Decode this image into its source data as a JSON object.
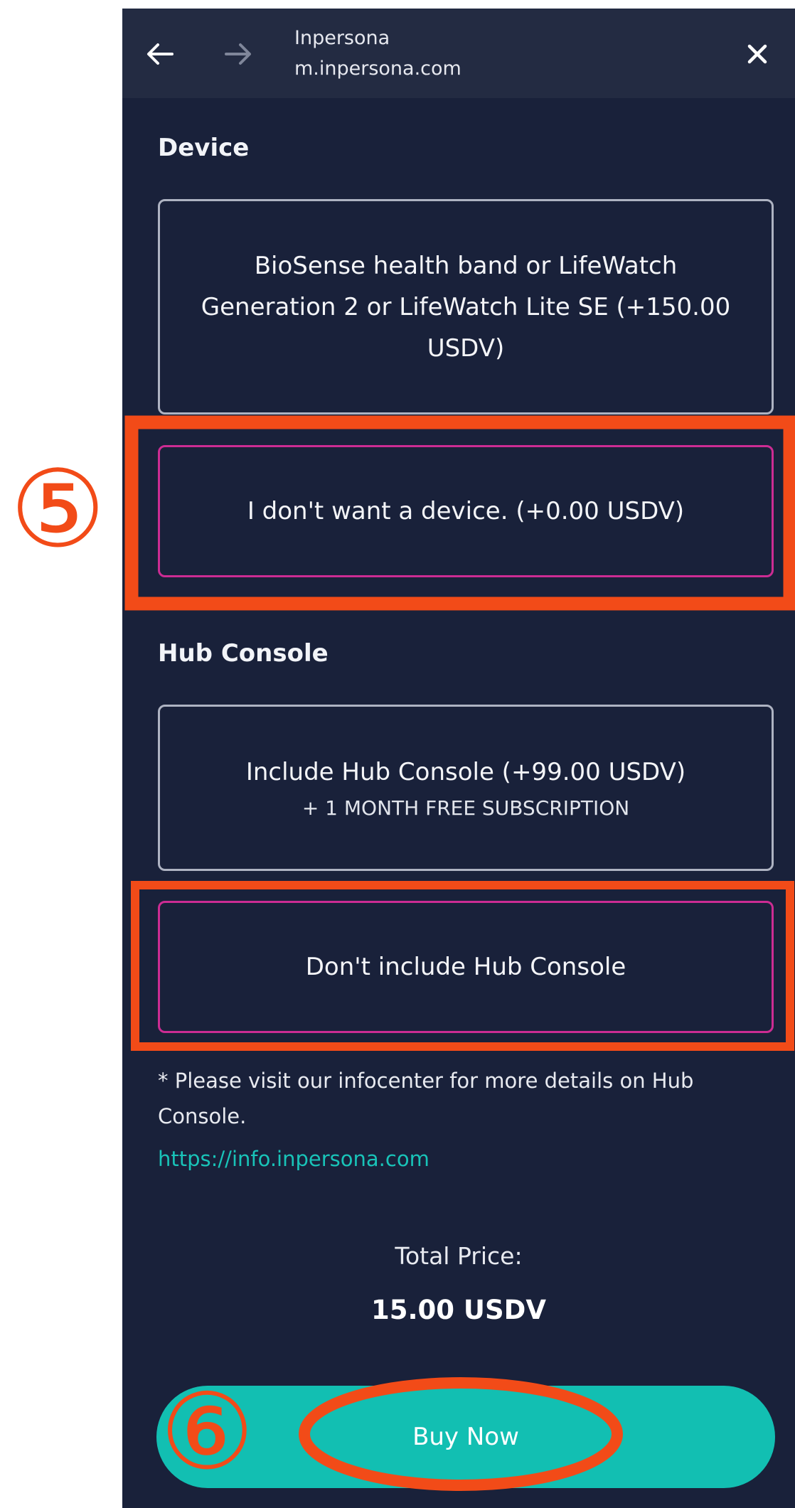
{
  "browser": {
    "site_title": "Inpersona",
    "site_url": "m.inpersona.com",
    "back_icon": "arrow-left-icon",
    "forward_icon": "arrow-right-icon",
    "close_icon": "close-icon"
  },
  "device": {
    "title": "Device",
    "options": [
      {
        "label": "BioSense health band or LifeWatch Generation 2 or LifeWatch Lite SE (+150.00 USDV)",
        "selected": false
      },
      {
        "label": "I don't want a device. (+0.00 USDV)",
        "selected": true
      }
    ]
  },
  "hub": {
    "title": "Hub Console",
    "options": [
      {
        "label": "Include Hub Console (+99.00 USDV)",
        "sublabel": "+ 1 MONTH FREE SUBSCRIPTION",
        "selected": false
      },
      {
        "label": "Don't include Hub Console",
        "selected": true
      }
    ],
    "note": "* Please visit our infocenter for more details on Hub Console.",
    "link": "https://info.inpersona.com"
  },
  "total": {
    "label": "Total Price:",
    "value": "15.00 USDV"
  },
  "buy_button": "Buy Now",
  "annotations": {
    "step5": "⑤",
    "step6": "⑥"
  },
  "colors": {
    "page_background": "#19213a",
    "top_bar": "#232b42",
    "selected_border": "#cc2c93",
    "accent_teal": "#12bfb2",
    "annotation_red": "#f24b18"
  }
}
